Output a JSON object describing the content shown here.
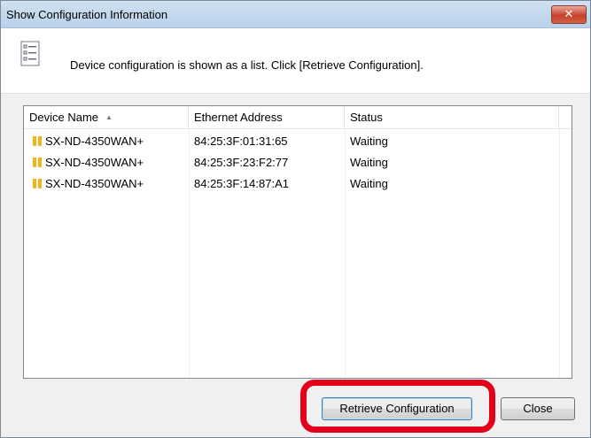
{
  "dialog": {
    "title": "Show Configuration Information",
    "close_glyph": "✕",
    "message": "Device configuration is shown as a list. Click [Retrieve Configuration].",
    "message_icon": "list-icon"
  },
  "list": {
    "columns": [
      "Device Name",
      "Ethernet Address",
      "Status"
    ],
    "rows": [
      {
        "name": "SX-ND-4350WAN+",
        "address": "84:25:3F:01:31:65",
        "status": "Waiting"
      },
      {
        "name": "SX-ND-4350WAN+",
        "address": "84:25:3F:23:F2:77",
        "status": "Waiting"
      },
      {
        "name": "SX-ND-4350WAN+",
        "address": "84:25:3F:14:87:A1",
        "status": "Waiting"
      }
    ],
    "device_icon": "device-icon",
    "device_icon_color": "#f0b31a"
  },
  "buttons": {
    "retrieve": "Retrieve Configuration",
    "close": "Close"
  },
  "colors": {
    "highlight": "#e3001b"
  }
}
